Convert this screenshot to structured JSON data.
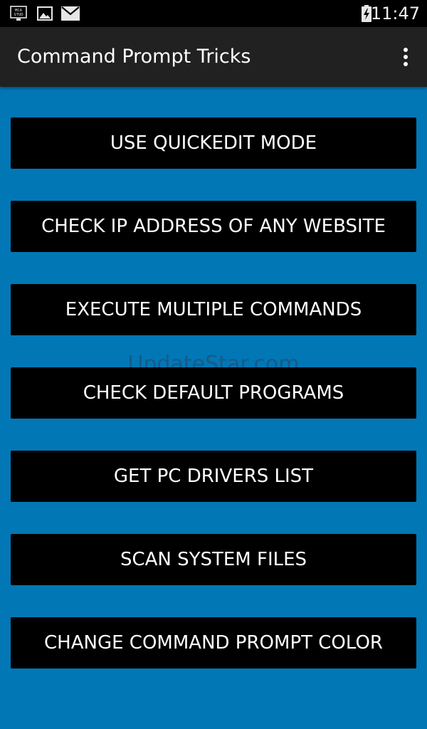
{
  "status_bar": {
    "time": "11:47",
    "app_icon_text_top": "MCA",
    "app_icon_text_bottom": "STUD",
    "icons": [
      "mca-study-app-icon",
      "image-icon",
      "mail-icon",
      "battery-charging-icon"
    ]
  },
  "app_bar": {
    "title": "Command Prompt Tricks",
    "menu_icon": "overflow-menu-icon"
  },
  "buttons": [
    "USE QUICKEDIT MODE",
    "CHECK IP ADDRESS OF ANY WEBSITE",
    "EXECUTE MULTIPLE COMMANDS",
    "CHECK DEFAULT PROGRAMS",
    "GET PC DRIVERS LIST",
    "SCAN SYSTEM FILES",
    "CHANGE COMMAND PROMPT COLOR"
  ],
  "watermark": "UpdateStar.com",
  "colors": {
    "background": "#0277b5",
    "app_bar": "#212121",
    "status_bar": "#000000",
    "button": "#000000",
    "button_text": "#ffffff"
  }
}
